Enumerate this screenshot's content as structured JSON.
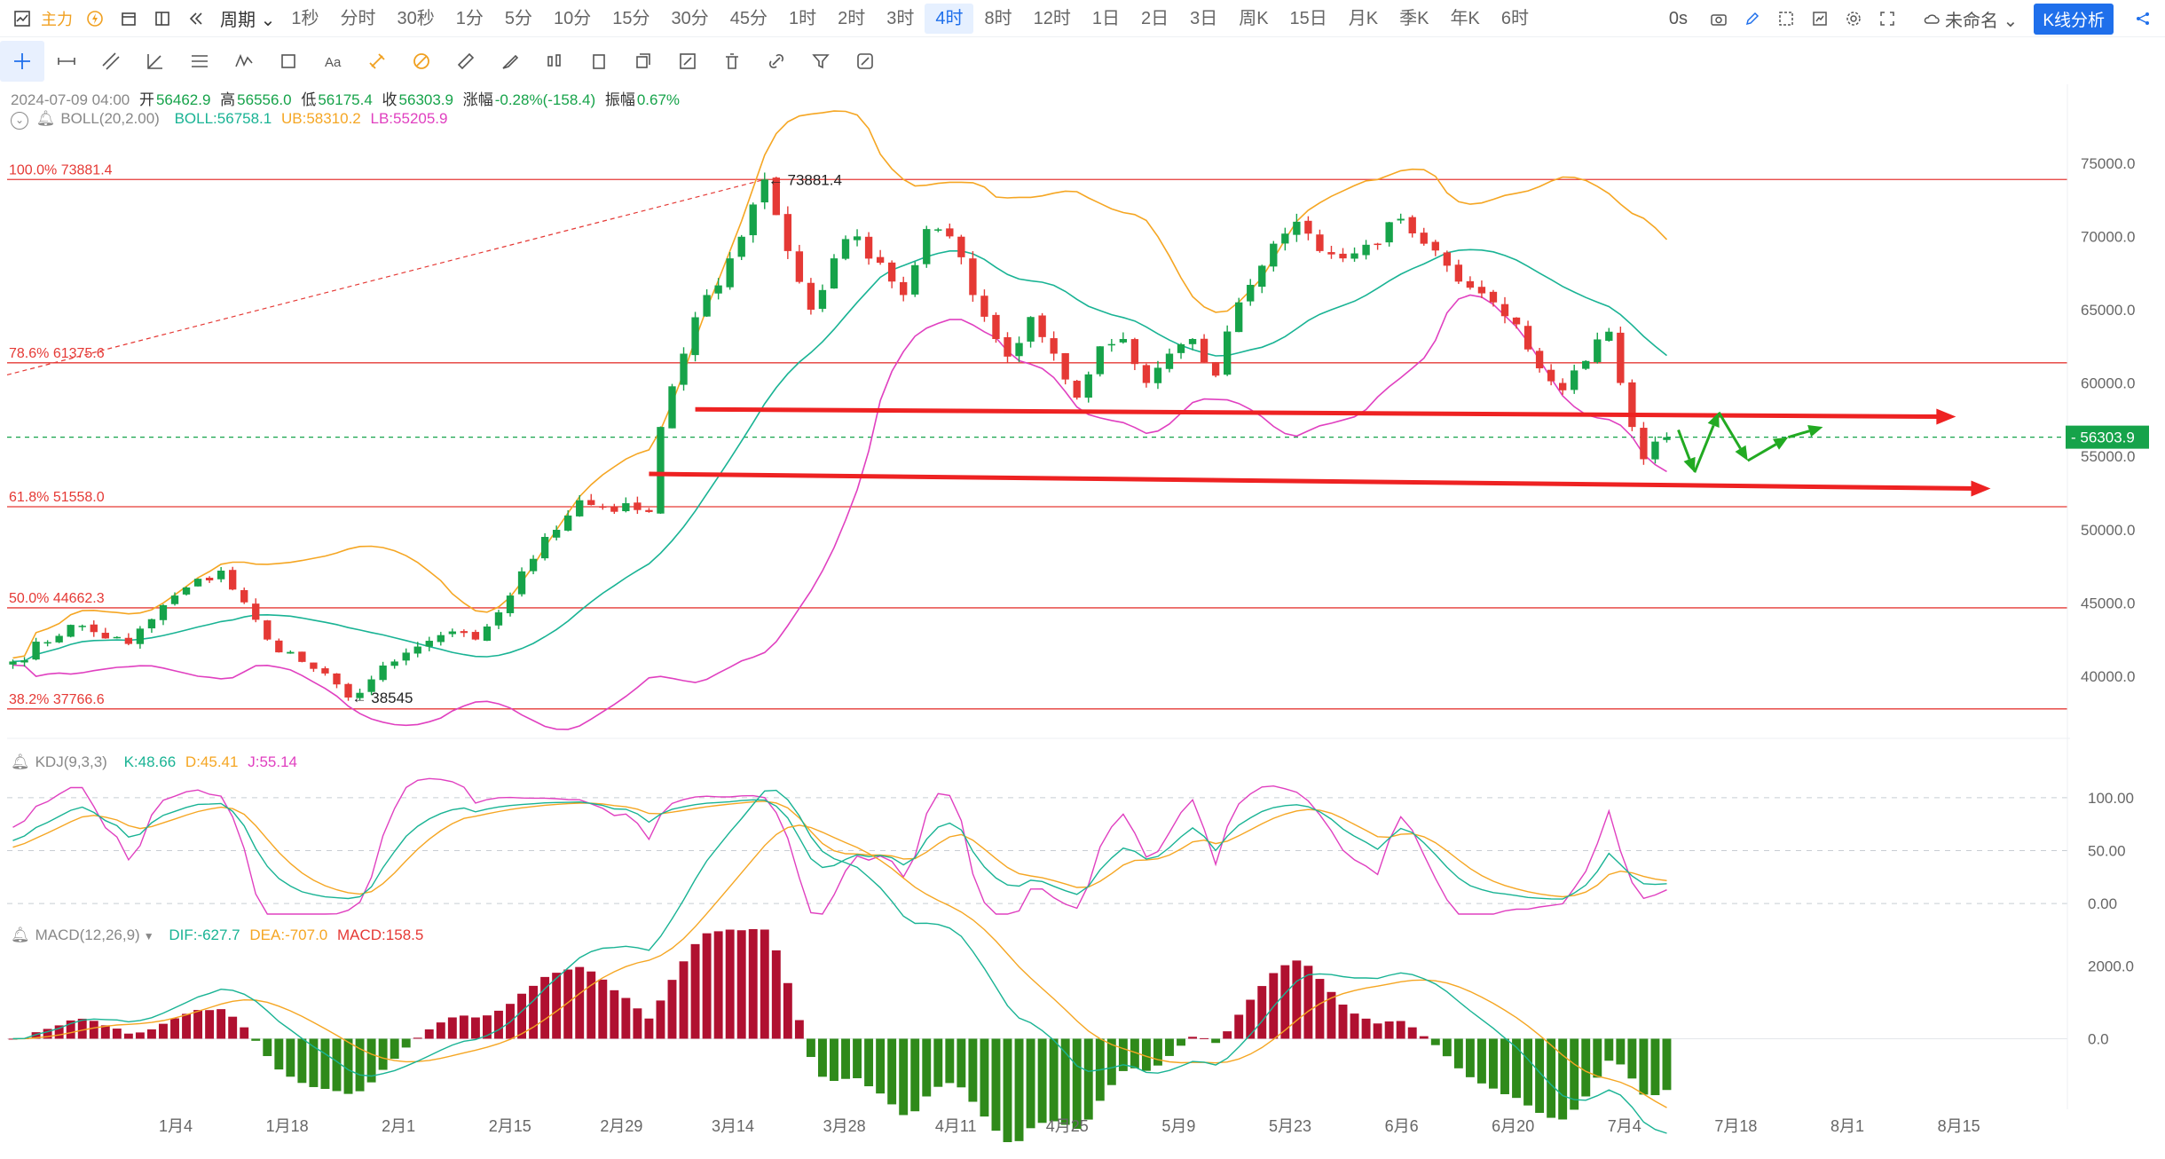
{
  "toolbar": {
    "main_label": "主力",
    "period_label": "周期",
    "periods": [
      "1秒",
      "分时",
      "30秒",
      "1分",
      "5分",
      "10分",
      "15分",
      "30分",
      "45分",
      "1时",
      "2时",
      "3时",
      "4时",
      "8时",
      "12时",
      "1日",
      "2日",
      "3日",
      "周K",
      "15日",
      "月K",
      "季K",
      "年K",
      "6时"
    ],
    "active_period": "4时",
    "countdown": "0s",
    "template_name": "未命名",
    "kline_button": "K线分析"
  },
  "info_bar": {
    "date": "2024-07-09 04:00",
    "open_label": "开",
    "open": "56462.9",
    "high_label": "高",
    "high": "56556.0",
    "low_label": "低",
    "low": "56175.4",
    "close_label": "收",
    "close": "56303.9",
    "change_label": "涨幅",
    "change": "-0.28%(-158.4)",
    "amplitude_label": "振幅",
    "amplitude": "0.67%"
  },
  "boll": {
    "label": "BOLL(20,2.00)",
    "mid_label": "BOLL:",
    "mid": "56758.1",
    "ub_label": "UB:",
    "ub": "58310.2",
    "lb_label": "LB:",
    "lb": "55205.9"
  },
  "kdj": {
    "label": "KDJ(9,3,3)",
    "k_label": "K:",
    "k": "48.66",
    "d_label": "D:",
    "d": "45.41",
    "j_label": "J:",
    "j": "55.14"
  },
  "macd": {
    "label": "MACD(12,26,9)",
    "dif_label": "DIF:",
    "dif": "-627.7",
    "dea_label": "DEA:",
    "dea": "-707.0",
    "macd_label": "MACD:",
    "macd": "158.5"
  },
  "colors": {
    "up": "#16a34a",
    "down": "#e53935",
    "boll_mid": "#19b394",
    "boll_ub": "#f5a623",
    "boll_lb": "#e040c0",
    "fib": "#e53935",
    "arrow_red": "#ee2222",
    "arrow_green": "#22aa22",
    "price_tag": "#16a34a"
  },
  "chart_data": {
    "type": "candlestick",
    "x_tick_labels": [
      "1月4",
      "1月18",
      "2月1",
      "2月15",
      "2月29",
      "3月14",
      "3月28",
      "4月11",
      "4月25",
      "5月9",
      "5月23",
      "6月6",
      "6月20",
      "7月4",
      "7月18",
      "8月1",
      "8月15"
    ],
    "price_axis_labels": [
      "75000.0",
      "70000.0",
      "65000.0",
      "60000.0",
      "55000.0",
      "50000.0",
      "45000.0",
      "40000.0"
    ],
    "ylim": [
      35880,
      77650
    ],
    "last_price": "56303.9",
    "close_anchors": [
      [
        0,
        41000
      ],
      [
        5,
        43500
      ],
      [
        10,
        42200
      ],
      [
        14,
        45500
      ],
      [
        18,
        47200
      ],
      [
        22,
        42500
      ],
      [
        26,
        40500
      ],
      [
        29,
        38545
      ],
      [
        33,
        41000
      ],
      [
        37,
        42800
      ],
      [
        40,
        42500
      ],
      [
        43,
        45500
      ],
      [
        46,
        49500
      ],
      [
        49,
        52000
      ],
      [
        51,
        51500
      ],
      [
        55,
        51200
      ],
      [
        56,
        57000
      ],
      [
        58,
        62000
      ],
      [
        60,
        66000
      ],
      [
        62,
        68500
      ],
      [
        65,
        73881
      ],
      [
        67,
        69000
      ],
      [
        69,
        65000
      ],
      [
        71,
        68500
      ],
      [
        73,
        70000
      ],
      [
        75,
        68200
      ],
      [
        77,
        66000
      ],
      [
        79,
        70500
      ],
      [
        81,
        70000
      ],
      [
        83,
        66000
      ],
      [
        85,
        63000
      ],
      [
        86,
        61800
      ],
      [
        88,
        64500
      ],
      [
        90,
        62000
      ],
      [
        92,
        59000
      ],
      [
        94,
        62500
      ],
      [
        96,
        63000
      ],
      [
        98,
        60000
      ],
      [
        100,
        62000
      ],
      [
        102,
        63000
      ],
      [
        104,
        60500
      ],
      [
        106,
        65500
      ],
      [
        108,
        68000
      ],
      [
        111,
        71000
      ],
      [
        113,
        69000
      ],
      [
        115,
        68500
      ],
      [
        118,
        69500
      ],
      [
        120,
        71200
      ],
      [
        122,
        69500
      ],
      [
        124,
        68000
      ],
      [
        126,
        66500
      ],
      [
        128,
        65500
      ],
      [
        130,
        64000
      ],
      [
        132,
        61000
      ],
      [
        134,
        59500
      ],
      [
        136,
        61500
      ],
      [
        138,
        63500
      ],
      [
        139,
        60000
      ],
      [
        140,
        57000
      ],
      [
        141,
        54800
      ],
      [
        142,
        56000
      ],
      [
        143,
        56303.9
      ]
    ],
    "fib_levels": [
      {
        "label": "100.0%",
        "value": 73881.4
      },
      {
        "label": "78.6%",
        "value": 61375.6
      },
      {
        "label": "61.8%",
        "value": 51558.0
      },
      {
        "label": "50.0%",
        "value": 44662.3
      },
      {
        "label": "38.2%",
        "value": 37766.6
      }
    ],
    "annotations": [
      {
        "text": "73881.4",
        "value": 73881.4
      },
      {
        "text": "38545",
        "value": 38545
      }
    ],
    "boll_values": {
      "mid": 56758.1,
      "ub": 58310.2,
      "lb": 55205.9
    },
    "kdj_axis_labels": [
      "100.00",
      "50.00",
      "0.00"
    ],
    "kdj_ylim": [
      -10,
      120
    ],
    "macd_axis_labels": [
      "2000.0",
      "0.0"
    ],
    "macd_ylim": [
      -1700,
      2700
    ],
    "red_arrows": [
      {
        "from": [
          59,
          58200
        ],
        "to": [
          168,
          57700
        ]
      },
      {
        "from": [
          55,
          53800
        ],
        "to": [
          171,
          52800
        ]
      }
    ],
    "green_arrows": [
      {
        "points": [
          [
            144,
            56800
          ],
          [
            145.4,
            53900
          ],
          [
            147.5,
            58000
          ],
          [
            150,
            54700
          ],
          [
            153.5,
            56300
          ],
          [
            156.5,
            57000
          ]
        ]
      }
    ]
  }
}
